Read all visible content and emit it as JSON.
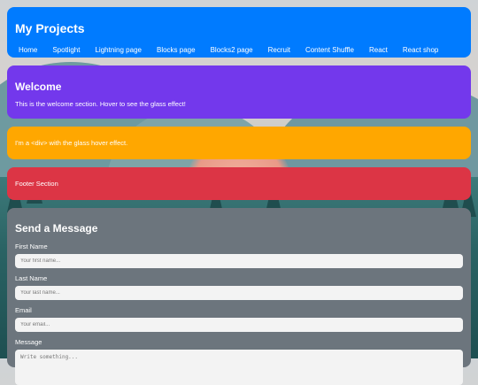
{
  "navbar": {
    "brand": "My Projects",
    "links": [
      "Home",
      "Spotlight",
      "Lightning page",
      "Blocks page",
      "Blocks2 page",
      "Recruit",
      "Content Shuffle",
      "React",
      "React shop"
    ]
  },
  "welcome": {
    "title": "Welcome",
    "text": "This is the welcome section. Hover to see the glass effect!"
  },
  "glass_section": {
    "text": "I'm a <div> with the glass hover effect."
  },
  "footer": {
    "text": "Footer Section"
  },
  "contact": {
    "title": "Send a Message",
    "first_name_label": "First Name",
    "first_name_placeholder": "Your first name...",
    "last_name_label": "Last Name",
    "last_name_placeholder": "Your last name...",
    "email_label": "Email",
    "email_placeholder": "Your email...",
    "message_label": "Message",
    "message_placeholder": "Write something..."
  },
  "colors": {
    "navbar": "#007bff",
    "welcome": "#7338ec",
    "glass": "#ffa700",
    "footer": "#dc3545",
    "contact": "#6c757d"
  }
}
